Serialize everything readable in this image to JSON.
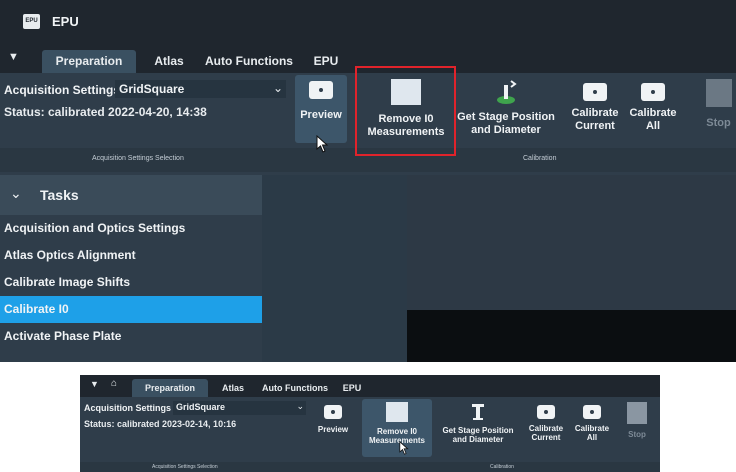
{
  "top": {
    "app_title": "EPU",
    "app_logo_text": "EPU",
    "tasks_title": "Tasks"
  },
  "tabs": [
    "Preparation",
    "Atlas",
    "Auto Functions",
    "EPU"
  ],
  "acquisition": {
    "label": "Acquisition Settings",
    "selected": "GridSquare"
  },
  "top_status": "Status: calibrated 2022-04-20, 14:38",
  "bottom_status": "Status: calibrated 2023-02-14, 10:16",
  "buttons": {
    "preview": "Preview",
    "remove_i0": "Remove I0 Measurements",
    "get_stage": "Get Stage Position and Diameter",
    "calibrate_current": "Calibrate Current",
    "calibrate_all": "Calibrate All",
    "stop": "Stop"
  },
  "sections": {
    "acq_selection": "Acquisition Settings Selection",
    "calibration": "Calibration"
  },
  "tasks": [
    "Acquisition and Optics Settings",
    "Atlas Optics Alignment",
    "Calibrate Image Shifts",
    "Calibrate I0",
    "Activate Phase Plate"
  ],
  "selected_task": "Calibrate I0",
  "colors": {
    "accent": "#1ea0e8",
    "highlight": "#e0232b",
    "ribbon": "#2f3d4a",
    "titlebar": "#1f262e"
  }
}
